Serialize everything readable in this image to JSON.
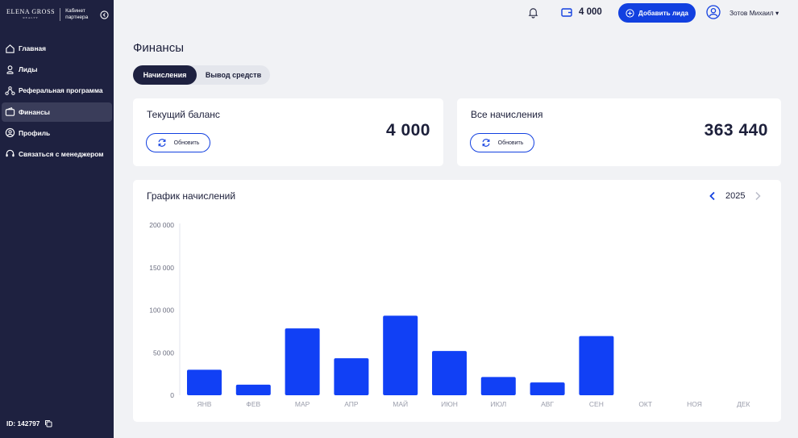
{
  "sidebar": {
    "brand": "ELENA GROSS",
    "brand_sub": "REALTY",
    "cabinet": "Кабинет партнера",
    "items": [
      {
        "label": "Главная",
        "icon": "home-icon",
        "active": false
      },
      {
        "label": "Лиды",
        "icon": "leads-icon",
        "active": false
      },
      {
        "label": "Реферальная программа",
        "icon": "referral-icon",
        "active": false
      },
      {
        "label": "Финансы",
        "icon": "finance-icon",
        "active": true
      },
      {
        "label": "Профиль",
        "icon": "profile-icon",
        "active": false
      },
      {
        "label": "Связаться с менеджером",
        "icon": "headset-icon",
        "active": false
      }
    ],
    "user_id": "ID: 142797"
  },
  "topbar": {
    "balance": "4 000",
    "add_lead_label": "Добавить лида",
    "username": "Зотов Михаил ▾"
  },
  "page": {
    "title": "Финансы",
    "tabs": [
      "Начисления",
      "Вывод средств"
    ],
    "active_tab": "Начисления"
  },
  "cards": {
    "balance": {
      "title": "Текущий баланс",
      "value": "4 000",
      "button": "Обновить"
    },
    "total": {
      "title": "Все начисления",
      "value": "363 440",
      "button": "Обновить"
    }
  },
  "chart_section": {
    "title": "График начислений",
    "year": "2025"
  },
  "colors": {
    "accent": "#1240e0",
    "sidebar_bg": "#1e2140",
    "background": "#f1f2f5",
    "bar": "#1140f5"
  },
  "chart_data": {
    "type": "bar",
    "title": "График начислений",
    "categories": [
      "ЯНВ",
      "ФЕВ",
      "МАР",
      "АПР",
      "МАЙ",
      "ИЮН",
      "ИЮЛ",
      "АВГ",
      "СЕН",
      "ОКТ",
      "НОЯ",
      "ДЕК"
    ],
    "values": [
      30000,
      12500,
      78500,
      43500,
      93500,
      52000,
      21500,
      15000,
      69500,
      0,
      0,
      0
    ],
    "y_ticks": [
      "0",
      "50 000",
      "100 000",
      "150 000",
      "200 000"
    ],
    "ylim": [
      0,
      200000
    ],
    "grid": false,
    "legend": "none"
  }
}
